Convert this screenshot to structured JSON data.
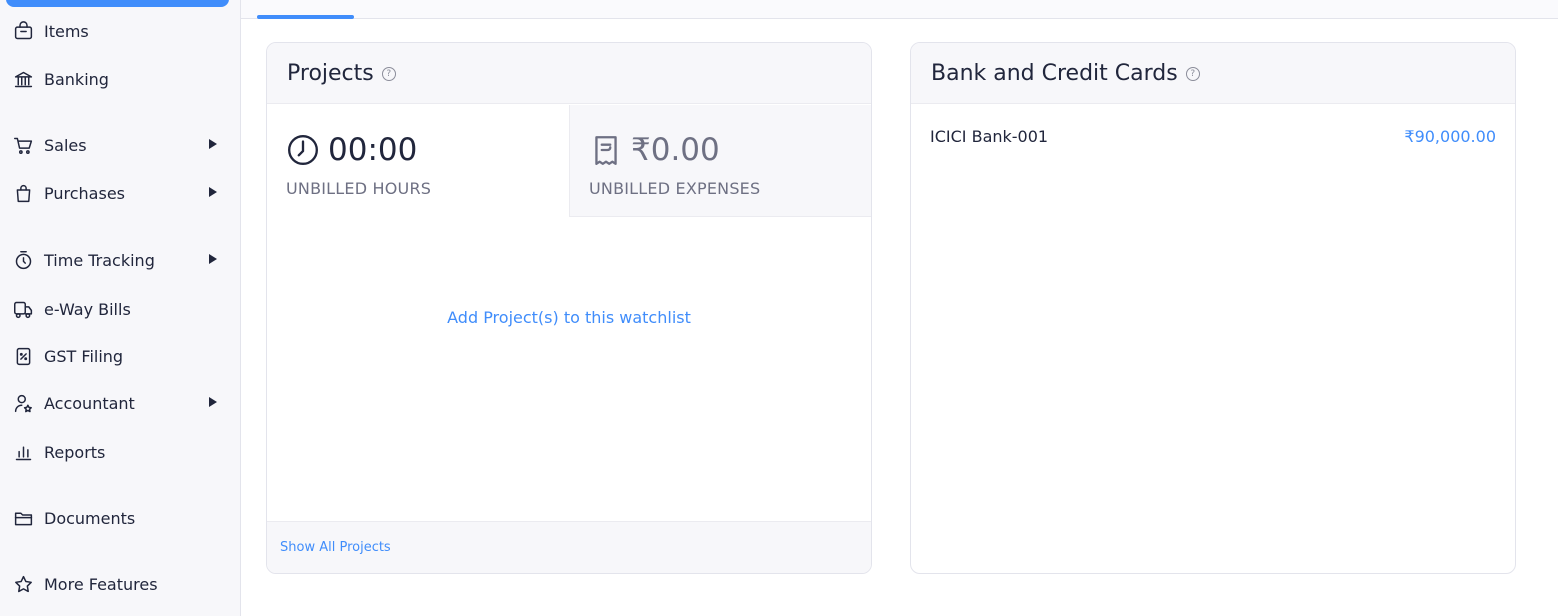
{
  "sidebar": {
    "items": [
      {
        "label": "Items",
        "icon": "basket-icon",
        "has_submenu": false
      },
      {
        "label": "Banking",
        "icon": "bank-icon",
        "has_submenu": false
      },
      {
        "label": "Sales",
        "icon": "cart-icon",
        "has_submenu": true
      },
      {
        "label": "Purchases",
        "icon": "bag-icon",
        "has_submenu": true
      },
      {
        "label": "Time Tracking",
        "icon": "stopwatch-icon",
        "has_submenu": true
      },
      {
        "label": "e-Way Bills",
        "icon": "truck-icon",
        "has_submenu": false
      },
      {
        "label": "GST Filing",
        "icon": "percent-doc-icon",
        "has_submenu": false
      },
      {
        "label": "Accountant",
        "icon": "accountant-icon",
        "has_submenu": true
      },
      {
        "label": "Reports",
        "icon": "bar-chart-icon",
        "has_submenu": false
      },
      {
        "label": "Documents",
        "icon": "folder-icon",
        "has_submenu": false
      },
      {
        "label": "More Features",
        "icon": "star-icon",
        "has_submenu": false
      }
    ]
  },
  "projects": {
    "title": "Projects",
    "help_glyph": "?",
    "unbilled_hours_value": "00:00",
    "unbilled_hours_label": "UNBILLED HOURS",
    "unbilled_expenses_value": "₹0.00",
    "unbilled_expenses_label": "UNBILLED EXPENSES",
    "add_link": "Add Project(s) to this watchlist",
    "footer_link": "Show All Projects"
  },
  "bank_cards": {
    "title": "Bank and Credit Cards",
    "help_glyph": "?",
    "accounts": [
      {
        "name": "ICICI Bank-001",
        "amount": "₹90,000.00"
      }
    ]
  },
  "colors": {
    "accent": "#408dfb",
    "text": "#21263c",
    "muted": "#6e7083",
    "panel": "#f7f7fa"
  }
}
